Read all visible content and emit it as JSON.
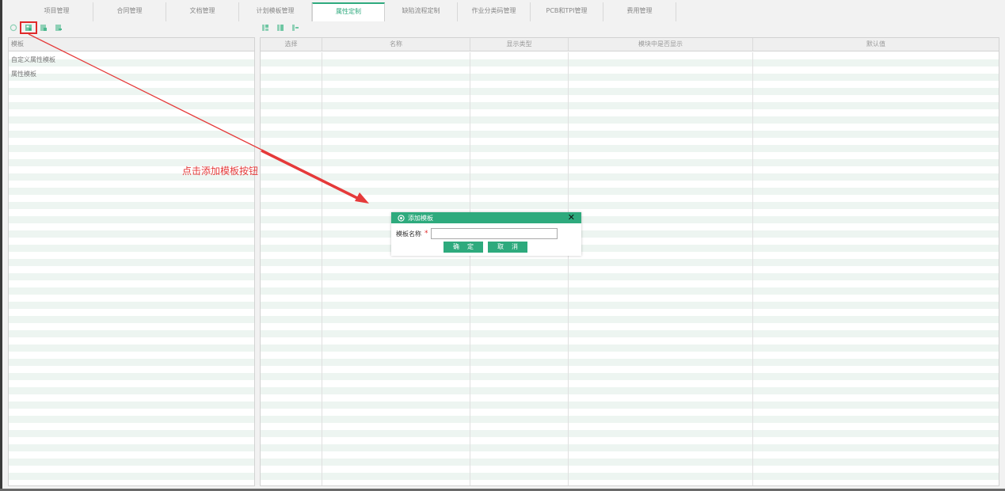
{
  "tabs": [
    {
      "label": "项目管理"
    },
    {
      "label": "合同管理"
    },
    {
      "label": "文档管理"
    },
    {
      "label": "计划模板管理"
    },
    {
      "label": "属性定制",
      "active": true
    },
    {
      "label": "缺陷流程定制"
    },
    {
      "label": "作业分类码管理"
    },
    {
      "label": "PCB和TPI管理"
    },
    {
      "label": "费用管理"
    }
  ],
  "left_panel": {
    "header": "模板",
    "items": [
      "自定义属性模板",
      "属性模板"
    ]
  },
  "right_panel": {
    "columns": [
      "选择",
      "名称",
      "显示类型",
      "模块中是否显示",
      "默认值"
    ]
  },
  "annotation": {
    "text": "点击添加模板按钮"
  },
  "dialog": {
    "title": "添加模板",
    "field_label": "模板名称",
    "required_mark": "*",
    "input_value": "",
    "ok_label": "确定",
    "cancel_label": "取消"
  },
  "icons": {
    "left_toolbar": [
      "refresh-icon",
      "add-template-icon",
      "edit-template-icon",
      "delete-template-icon"
    ],
    "right_toolbar": [
      "add-attribute-icon",
      "edit-attribute-icon",
      "delete-attribute-icon"
    ]
  },
  "colors": {
    "accent": "#2eaa7d",
    "annotation": "#e53a3a",
    "row_stripe": "#edf5f1"
  }
}
